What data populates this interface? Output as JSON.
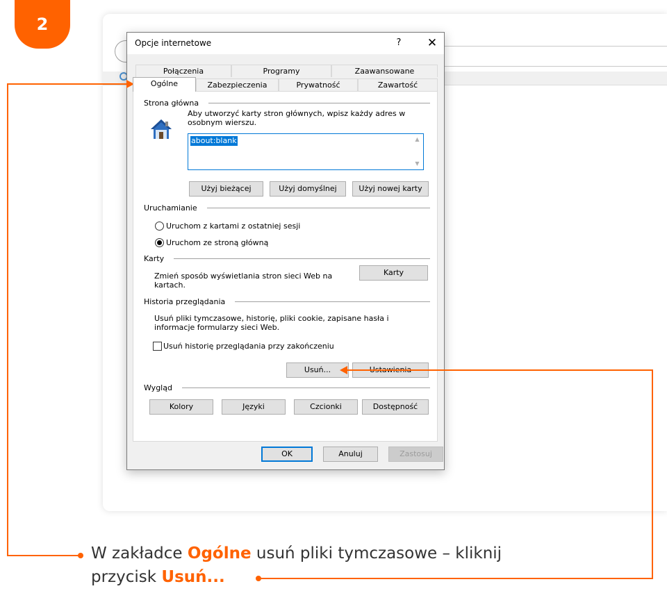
{
  "step_number": "2",
  "colors": {
    "accent": "#ff6200",
    "selection": "#0078d7"
  },
  "dialog": {
    "title": "Opcje internetowe",
    "help_label": "?",
    "close_label": "✕",
    "tabs_row1": [
      "Połączenia",
      "Programy",
      "Zaawansowane"
    ],
    "tabs_row2": [
      "Ogólne",
      "Zabezpieczenia",
      "Prywatność",
      "Zawartość"
    ],
    "active_tab": "Ogólne",
    "home": {
      "group_label": "Strona główna",
      "desc_line1": "Aby utworzyć karty stron głównych, wpisz każdy adres w",
      "desc_line2": "osobnym wierszu.",
      "url_value": "about:blank",
      "icon": "house-icon",
      "buttons": [
        "Użyj bieżącej",
        "Użyj domyślnej",
        "Użyj nowej karty"
      ]
    },
    "startup": {
      "group_label": "Uruchamianie",
      "option1": "Uruchom z kartami z ostatniej sesji",
      "option2": "Uruchom ze stroną główną",
      "selected": "option2"
    },
    "tabs_section": {
      "group_label": "Karty",
      "desc_line1": "Zmień sposób wyświetlania stron sieci Web na",
      "desc_line2": "kartach.",
      "button": "Karty"
    },
    "history": {
      "group_label": "Historia przeglądania",
      "desc_line1": "Usuń pliki tymczasowe, historię, pliki cookie, zapisane hasła i",
      "desc_line2": "informacje formularzy sieci Web.",
      "checkbox_label": "Usuń historię przeglądania przy zakończeniu",
      "checkbox_checked": false,
      "delete_button": "Usuń...",
      "settings_button": "Ustawienia"
    },
    "appearance": {
      "group_label": "Wygląd",
      "buttons": [
        "Kolory",
        "Języki",
        "Czcionki",
        "Dostępność"
      ]
    },
    "footer": {
      "ok": "OK",
      "cancel": "Anuluj",
      "apply": "Zastosuj"
    }
  },
  "caption": {
    "part1": "W zakładce ",
    "bold1": "Ogólne",
    "part2": " usuń pliki tymczasowe – kliknij",
    "part3": "przycisk ",
    "bold2": "Usuń..."
  }
}
